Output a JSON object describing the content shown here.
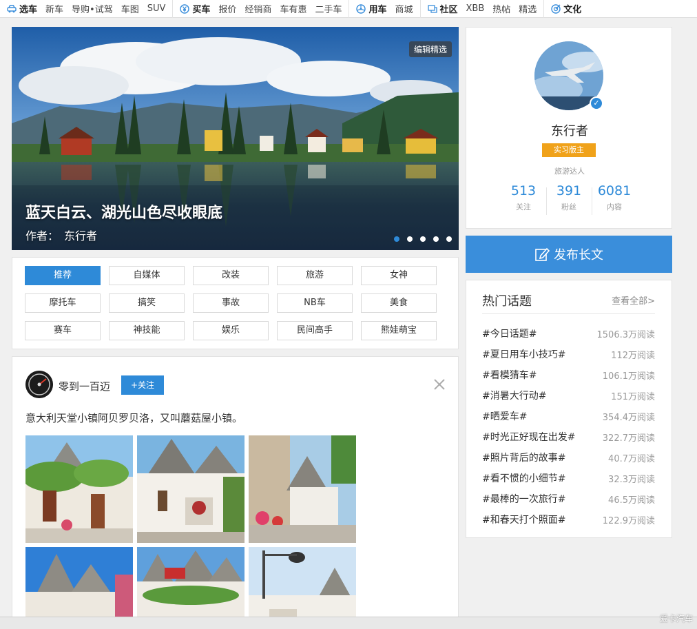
{
  "nav": {
    "groups": [
      {
        "head": "选车",
        "icon": "car-icon",
        "links": [
          "新车",
          "导购•试驾",
          "车图",
          "SUV"
        ]
      },
      {
        "head": "买车",
        "icon": "yen-icon",
        "links": [
          "报价",
          "经销商",
          "车有惠",
          "二手车"
        ]
      },
      {
        "head": "用车",
        "icon": "wheel-icon",
        "links": [
          "商城"
        ]
      },
      {
        "head": "社区",
        "icon": "chat-icon",
        "links": [
          "XBB",
          "热帖",
          "精选"
        ]
      },
      {
        "head": "文化",
        "icon": "target-icon",
        "links": []
      }
    ]
  },
  "slider": {
    "badge": "编辑精选",
    "title": "蓝天白云、湖光山色尽收眼底",
    "author_label": "作者：",
    "author": "东行者",
    "dot_count": 5,
    "active_dot": 0
  },
  "tags": [
    [
      "推荐",
      "自媒体",
      "改装",
      "旅游",
      "女神"
    ],
    [
      "摩托车",
      "搞笑",
      "事故",
      "NB车",
      "美食"
    ],
    [
      "赛车",
      "神技能",
      "娱乐",
      "民间高手",
      "熊娃萌宝"
    ]
  ],
  "active_tag": "推荐",
  "post": {
    "author": "零到一百迈",
    "follow_label": "+关注",
    "text": "意大利天堂小镇阿贝罗贝洛，又叫蘑菇屋小镇。",
    "photo_count": 6
  },
  "profile": {
    "name": "东行者",
    "badge": "实习版主",
    "role": "旅游达人",
    "verified_icon": "✓",
    "stats": [
      {
        "value": "513",
        "label": "关注"
      },
      {
        "value": "391",
        "label": "粉丝"
      },
      {
        "value": "6081",
        "label": "内容"
      }
    ]
  },
  "publish": {
    "label": "发布长文"
  },
  "hot_topics": {
    "title": "热门话题",
    "more": "查看全部>",
    "items": [
      {
        "name": "#今日话题#",
        "reads": "1506.3万阅读"
      },
      {
        "name": "#夏日用车小技巧#",
        "reads": "112万阅读"
      },
      {
        "name": "#看模猜车#",
        "reads": "106.1万阅读"
      },
      {
        "name": "#消暑大行动#",
        "reads": "151万阅读"
      },
      {
        "name": "#晒爱车#",
        "reads": "354.4万阅读"
      },
      {
        "name": "#时光正好现在出发#",
        "reads": "322.7万阅读"
      },
      {
        "name": "#照片背后的故事#",
        "reads": "40.7万阅读"
      },
      {
        "name": "#看不惯的小细节#",
        "reads": "32.3万阅读"
      },
      {
        "name": "#最棒的一次旅行#",
        "reads": "46.5万阅读"
      },
      {
        "name": "#和春天打个照面#",
        "reads": "122.9万阅读"
      }
    ]
  },
  "watermark": "爱卡汽车",
  "colors": {
    "accent": "#2e8ad8",
    "badge": "#f0a21a",
    "publish": "#3a8edb"
  }
}
